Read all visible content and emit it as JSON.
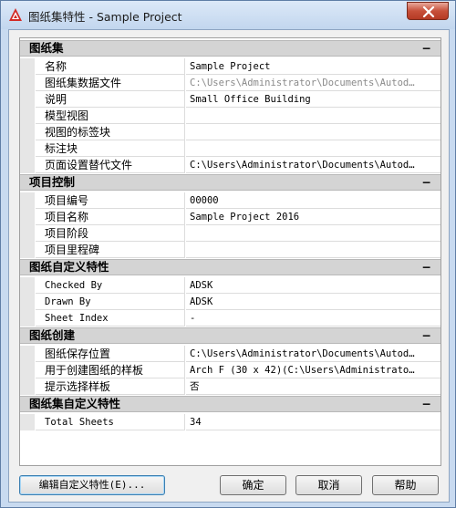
{
  "window": {
    "title": "图纸集特性 - Sample Project",
    "close_label": "✕"
  },
  "sections": [
    {
      "title": "图纸集",
      "toggle": "−",
      "rows": [
        {
          "name": "名称",
          "value": "Sample Project",
          "dim": false
        },
        {
          "name": "图纸集数据文件",
          "value": "C:\\Users\\Administrator\\Documents\\Autod…",
          "dim": true
        },
        {
          "name": "说明",
          "value": "Small Office Building",
          "dim": false
        },
        {
          "name": "模型视图",
          "value": "",
          "dim": false
        },
        {
          "name": "视图的标签块",
          "value": "",
          "dim": false
        },
        {
          "name": "标注块",
          "value": "",
          "dim": false
        },
        {
          "name": "页面设置替代文件",
          "value": "C:\\Users\\Administrator\\Documents\\Autod…",
          "dim": false
        }
      ]
    },
    {
      "title": "项目控制",
      "toggle": "−",
      "rows": [
        {
          "name": "项目编号",
          "value": "00000",
          "dim": false
        },
        {
          "name": "项目名称",
          "value": "Sample Project 2016",
          "dim": false
        },
        {
          "name": "项目阶段",
          "value": "",
          "dim": false
        },
        {
          "name": "项目里程碑",
          "value": "",
          "dim": false
        }
      ]
    },
    {
      "title": "图纸自定义特性",
      "toggle": "−",
      "rows": [
        {
          "name": "Checked By",
          "value": "ADSK",
          "dim": false
        },
        {
          "name": "Drawn By",
          "value": "ADSK",
          "dim": false
        },
        {
          "name": "Sheet Index",
          "value": "-",
          "dim": false
        }
      ]
    },
    {
      "title": "图纸创建",
      "toggle": "−",
      "rows": [
        {
          "name": "图纸保存位置",
          "value": "C:\\Users\\Administrator\\Documents\\Autod…",
          "dim": false
        },
        {
          "name": "用于创建图纸的样板",
          "value": "Arch F (30 x 42)(C:\\Users\\Administrato…",
          "dim": false
        },
        {
          "name": "提示选择样板",
          "value": "否",
          "dim": false
        }
      ]
    },
    {
      "title": "图纸集自定义特性",
      "toggle": "−",
      "rows": [
        {
          "name": "Total Sheets",
          "value": "34",
          "dim": false
        }
      ]
    }
  ],
  "buttons": {
    "edit": "编辑自定义特性(E)...",
    "ok": "确定",
    "cancel": "取消",
    "help": "帮助"
  },
  "colors": {
    "accent": "#c7503a",
    "section_bg": "#d4d4d4",
    "dim_text": "#8a8a8a"
  }
}
